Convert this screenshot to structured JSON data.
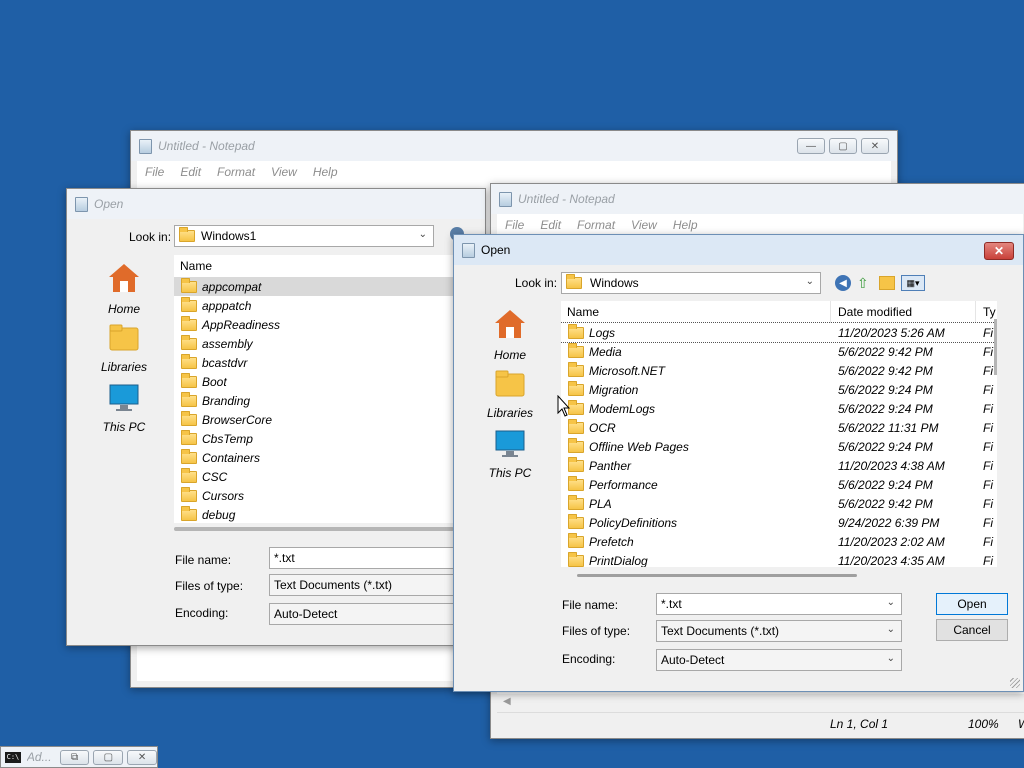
{
  "notepad_back": {
    "title": "Untitled - Notepad",
    "menu": [
      "File",
      "Edit",
      "Format",
      "View",
      "Help"
    ]
  },
  "notepad_front": {
    "title": "Untitled - Notepad",
    "menu": [
      "File",
      "Edit",
      "Format",
      "View",
      "Help"
    ],
    "status": {
      "position": "Ln 1, Col 1",
      "zoom": "100%",
      "extra": "W"
    }
  },
  "dialog_back": {
    "title": "Open",
    "look_in_label": "Look in:",
    "look_in_value": "Windows1",
    "places": [
      "Home",
      "Libraries",
      "This PC"
    ],
    "column_name": "Name",
    "items": [
      "appcompat",
      "apppatch",
      "AppReadiness",
      "assembly",
      "bcastdvr",
      "Boot",
      "Branding",
      "BrowserCore",
      "CbsTemp",
      "Containers",
      "CSC",
      "Cursors",
      "debug"
    ],
    "file_name_label": "File name:",
    "file_name_value": "*.txt",
    "file_type_label": "Files of type:",
    "file_type_value": "Text Documents (*.txt)",
    "encoding_label": "Encoding:",
    "encoding_value": "Auto-Detect"
  },
  "dialog_front": {
    "title": "Open",
    "look_in_label": "Look in:",
    "look_in_value": "Windows",
    "places": [
      "Home",
      "Libraries",
      "This PC"
    ],
    "columns": {
      "name": "Name",
      "date": "Date modified",
      "type": "Ty"
    },
    "items": [
      {
        "name": "Logs",
        "date": "11/20/2023 5:26 AM",
        "type": "Fi"
      },
      {
        "name": "Media",
        "date": "5/6/2022 9:42 PM",
        "type": "Fi"
      },
      {
        "name": "Microsoft.NET",
        "date": "5/6/2022 9:42 PM",
        "type": "Fi"
      },
      {
        "name": "Migration",
        "date": "5/6/2022 9:24 PM",
        "type": "Fi"
      },
      {
        "name": "ModemLogs",
        "date": "5/6/2022 9:24 PM",
        "type": "Fi"
      },
      {
        "name": "OCR",
        "date": "5/6/2022 11:31 PM",
        "type": "Fi"
      },
      {
        "name": "Offline Web Pages",
        "date": "5/6/2022 9:24 PM",
        "type": "Fi"
      },
      {
        "name": "Panther",
        "date": "11/20/2023 4:38 AM",
        "type": "Fi"
      },
      {
        "name": "Performance",
        "date": "5/6/2022 9:24 PM",
        "type": "Fi"
      },
      {
        "name": "PLA",
        "date": "5/6/2022 9:42 PM",
        "type": "Fi"
      },
      {
        "name": "PolicyDefinitions",
        "date": "9/24/2022 6:39 PM",
        "type": "Fi"
      },
      {
        "name": "Prefetch",
        "date": "11/20/2023 2:02 AM",
        "type": "Fi"
      },
      {
        "name": "PrintDialog",
        "date": "11/20/2023 4:35 AM",
        "type": "Fi"
      }
    ],
    "file_name_label": "File name:",
    "file_name_value": "*.txt",
    "file_type_label": "Files of type:",
    "file_type_value": "Text Documents (*.txt)",
    "encoding_label": "Encoding:",
    "encoding_value": "Auto-Detect",
    "open_label": "Open",
    "cancel_label": "Cancel"
  },
  "taskbar_window": {
    "title": "Ad..."
  },
  "icons": [
    "notepad-icon",
    "folder-icon",
    "home-icon",
    "libraries-icon",
    "this-pc-icon",
    "back-icon",
    "up-folder-icon",
    "new-folder-icon",
    "view-menu-icon",
    "close-icon",
    "minimize-icon",
    "maximize-icon",
    "console-icon"
  ],
  "colors": {
    "desktop": "#1f5fa6",
    "close_button": "#c9413a",
    "selection": "#d9d9d9"
  }
}
